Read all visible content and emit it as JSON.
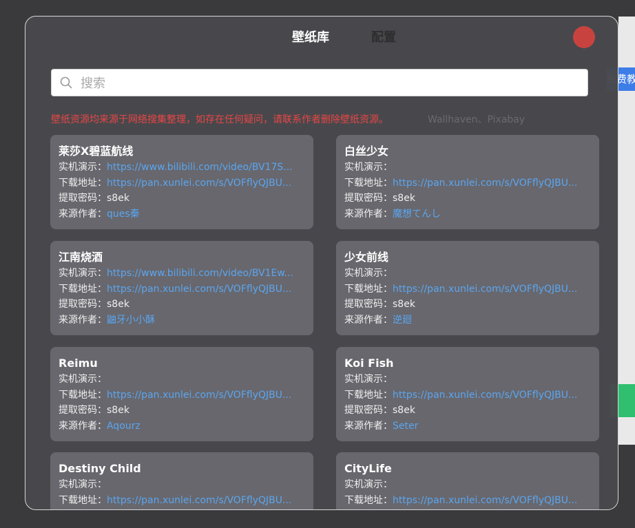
{
  "background": {
    "blue_button_label": "免费教程"
  },
  "modal": {
    "tabs": [
      {
        "label": "壁纸库",
        "active": true
      },
      {
        "label": "配置",
        "active": false
      }
    ],
    "close_color": "#c8433f"
  },
  "search": {
    "placeholder": "搜索",
    "value": ""
  },
  "notice": "壁纸资源均来源于网络搜集整理，如存在任何疑问，请联系作者删除壁纸资源。",
  "notice_tail": "Wallhaven、Pixabay",
  "labels": {
    "demo": "实机演示：",
    "download": "下载地址：",
    "code": "提取密码：",
    "author": "来源作者："
  },
  "cards": [
    {
      "title": "莱莎X碧蓝航线",
      "demo": "https://www.bilibili.com/video/BV17S...",
      "download": "https://pan.xunlei.com/s/VOFflyQJBU...",
      "code": "s8ek",
      "author": "ques秦"
    },
    {
      "title": "白丝少女",
      "demo": "",
      "download": "https://pan.xunlei.com/s/VOFflyQJBU...",
      "code": "s8ek",
      "author": "魔想てんし"
    },
    {
      "title": "江南烧酒",
      "demo": "https://www.bilibili.com/video/BV1Ew...",
      "download": "https://pan.xunlei.com/s/VOFflyQJBU...",
      "code": "s8ek",
      "author": "鼬牙小小酥"
    },
    {
      "title": "少女前线",
      "demo": "",
      "download": "https://pan.xunlei.com/s/VOFflyQJBU...",
      "code": "s8ek",
      "author": "逆廻"
    },
    {
      "title": "Reimu",
      "demo": "",
      "download": "https://pan.xunlei.com/s/VOFflyQJBU...",
      "code": "s8ek",
      "author": "Aqourz"
    },
    {
      "title": "Koi Fish",
      "demo": "",
      "download": "https://pan.xunlei.com/s/VOFflyQJBU...",
      "code": "s8ek",
      "author": "Seter"
    },
    {
      "title": "Destiny Child",
      "demo": "",
      "download": "https://pan.xunlei.com/s/VOFflyQJBU...",
      "code": "",
      "author": ""
    },
    {
      "title": "CityLife",
      "demo": "",
      "download": "https://pan.xunlei.com/s/VOFflyQJBU...",
      "code": "",
      "author": ""
    }
  ]
}
